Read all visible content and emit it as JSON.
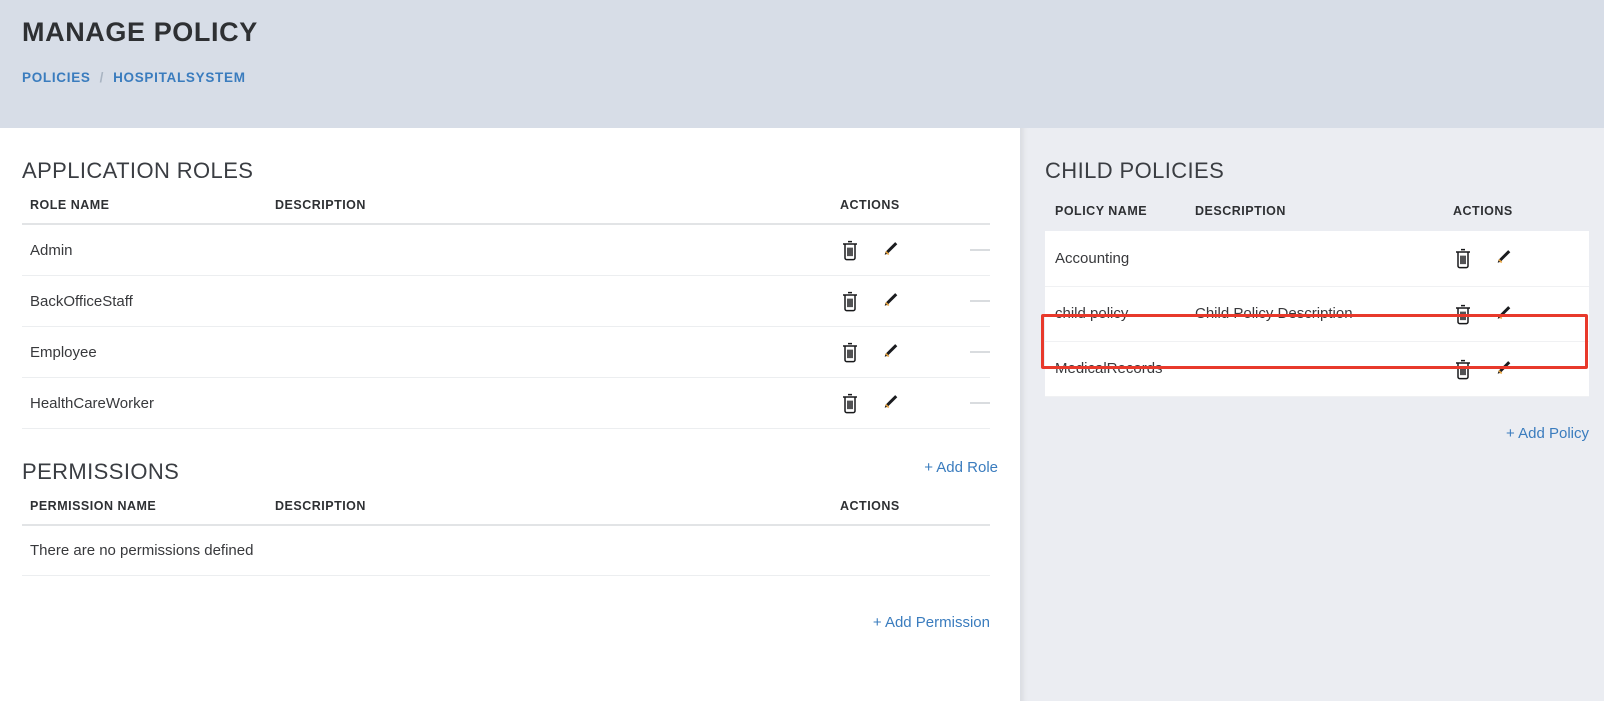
{
  "header": {
    "title": "MANAGE POLICY",
    "breadcrumb": {
      "root": "POLICIES",
      "separator": "/",
      "current": "HOSPITALSYSTEM"
    }
  },
  "application_roles": {
    "section_title": "APPLICATION ROLES",
    "columns": {
      "name": "ROLE NAME",
      "description": "DESCRIPTION",
      "actions": "ACTIONS"
    },
    "rows": [
      {
        "name": "Admin",
        "description": ""
      },
      {
        "name": "BackOfficeStaff",
        "description": ""
      },
      {
        "name": "Employee",
        "description": ""
      },
      {
        "name": "HealthCareWorker",
        "description": ""
      }
    ],
    "add_link": "+ Add Role"
  },
  "permissions": {
    "section_title": "PERMISSIONS",
    "columns": {
      "name": "PERMISSION NAME",
      "description": "DESCRIPTION",
      "actions": "ACTIONS"
    },
    "empty_message": "There are no permissions defined",
    "add_link": "+ Add Permission"
  },
  "child_policies": {
    "section_title": "CHILD POLICIES",
    "columns": {
      "name": "POLICY NAME",
      "description": "DESCRIPTION",
      "actions": "ACTIONS"
    },
    "rows": [
      {
        "name": "Accounting",
        "description": "",
        "highlighted": false
      },
      {
        "name": "child policy",
        "description": "Child Policy Description",
        "highlighted": true
      },
      {
        "name": "MedicalRecords",
        "description": "",
        "highlighted": false
      }
    ],
    "add_link": "+ Add Policy"
  },
  "icons": {
    "delete": "trash-icon",
    "edit": "pencil-icon"
  },
  "colors": {
    "header_background": "#d7dde7",
    "link_blue": "#3a7cbe",
    "panel_background": "#ebedf2",
    "highlight_red": "#e8392b",
    "text_dark": "#2e3033"
  }
}
